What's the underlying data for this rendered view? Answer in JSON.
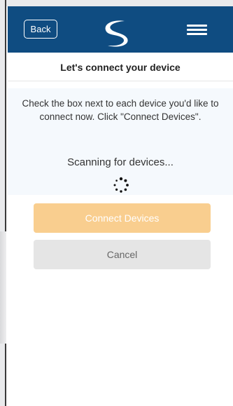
{
  "header": {
    "back_label": "Back",
    "logo_icon": "swirl-logo-icon",
    "menu_icon": "hamburger-menu-icon",
    "background_color": "#0f4c81"
  },
  "main": {
    "title": "Let's connect your device",
    "instructions": "Check the box next to each device you'd like to connect now. Click \"Connect Devices\".",
    "scanning_text": "Scanning for devices...",
    "spinner_icon": "loading-spinner-icon"
  },
  "actions": {
    "connect_label": "Connect Devices",
    "cancel_label": "Cancel",
    "connect_color": "#f9ce8f",
    "cancel_color": "#e5e5e5"
  }
}
